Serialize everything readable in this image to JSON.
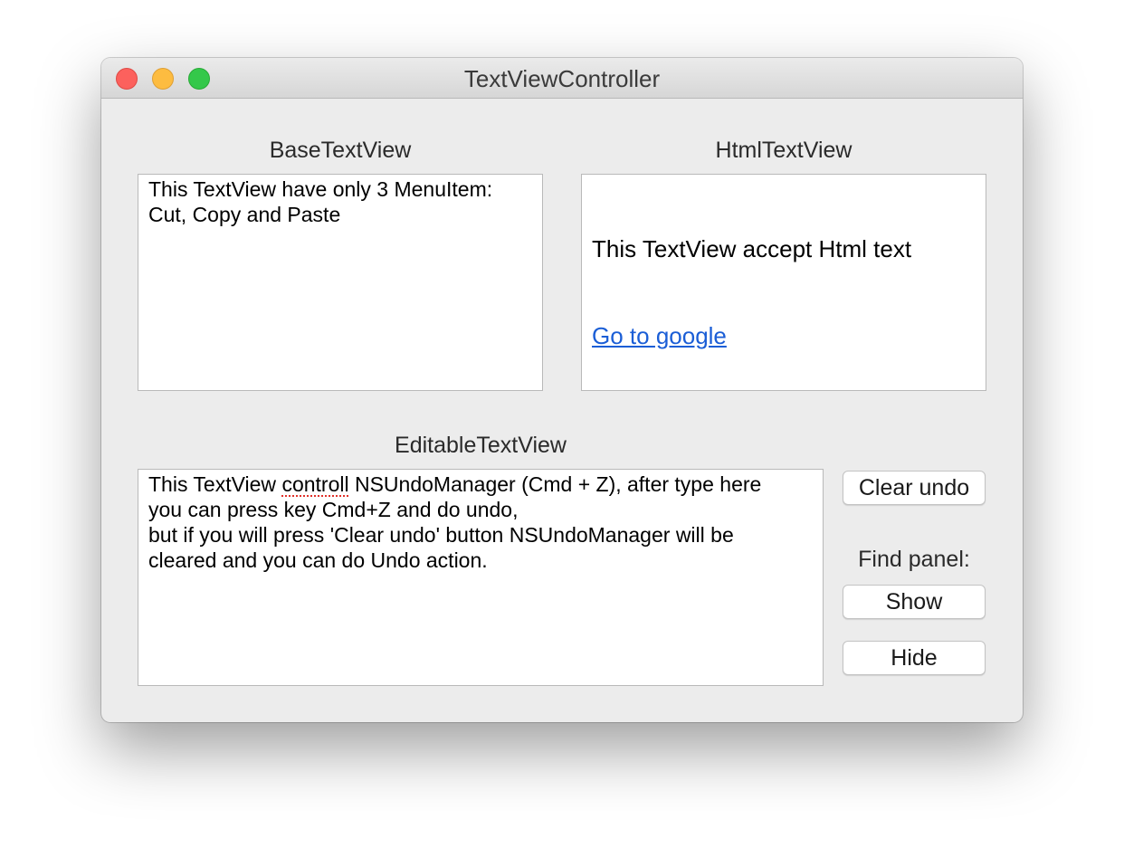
{
  "window": {
    "title": "TextViewController"
  },
  "base_text_view": {
    "label": "BaseTextView",
    "text": "This TextView have only 3 MenuItem:\nCut, Copy and Paste"
  },
  "html_text_view": {
    "label": "HtmlTextView",
    "text": "This TextView accept Html text",
    "link_text": "Go to google"
  },
  "editable_text_view": {
    "label": "EditableTextView",
    "line1_before": "This TextView ",
    "line1_misspelled": "controll",
    "line1_after": " NSUndoManager (Cmd + Z), after type here",
    "rest": "you can press key Cmd+Z and do undo,\nbut if you will press 'Clear undo' button NSUndoManager will be\ncleared and you can do Undo action."
  },
  "controls": {
    "clear_undo_label": "Clear undo",
    "find_panel_label": "Find panel:",
    "show_label": "Show",
    "hide_label": "Hide"
  },
  "colors": {
    "close": "#fc615d",
    "minimize": "#fdbc40",
    "zoom": "#34c84a",
    "link": "#1b5ed6",
    "spelling_underline": "#e0302a"
  }
}
